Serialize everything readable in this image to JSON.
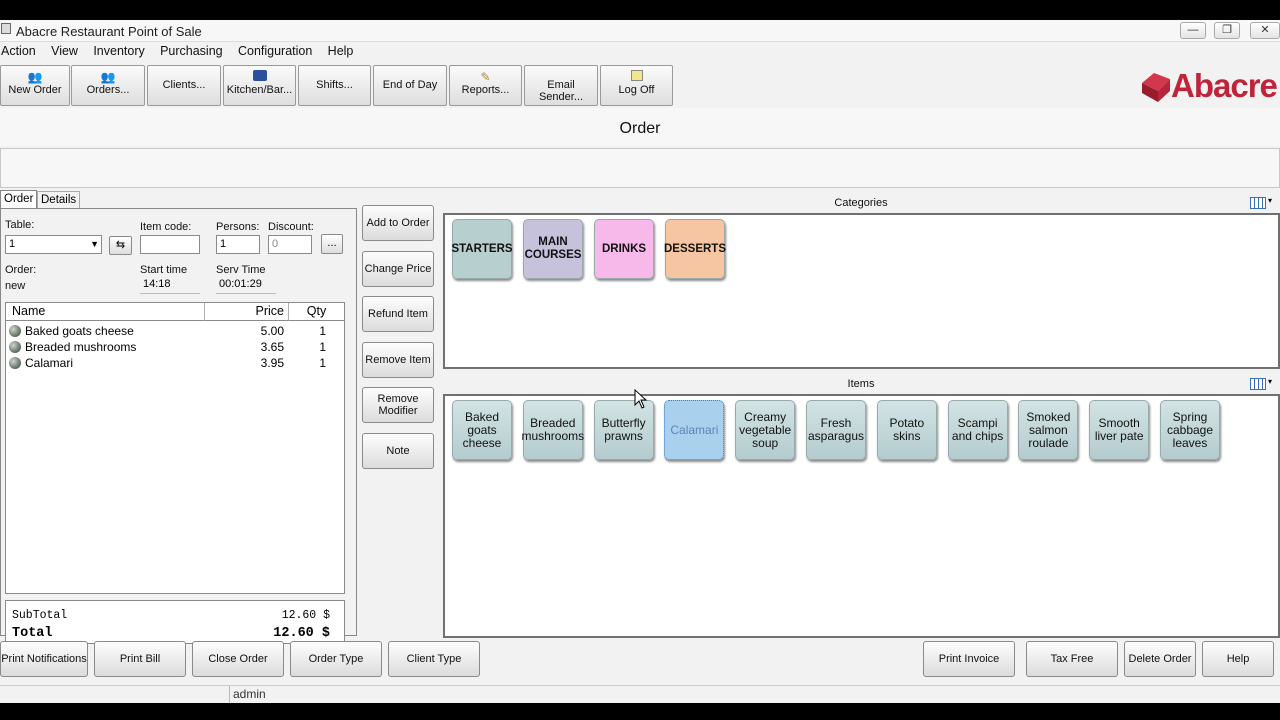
{
  "window": {
    "title": "Abacre Restaurant Point of Sale",
    "min": "—",
    "max": "❐",
    "close": "✕"
  },
  "menu": [
    "Action",
    "View",
    "Inventory",
    "Purchasing",
    "Configuration",
    "Help"
  ],
  "toolbar": [
    {
      "label": "New Order",
      "icon": "new-order-icon"
    },
    {
      "label": "Orders...",
      "icon": "orders-icon"
    },
    {
      "label": "Clients...",
      "icon": ""
    },
    {
      "label": "Kitchen/Bar...",
      "icon": "kitchen-icon"
    },
    {
      "label": "Shifts...",
      "icon": ""
    },
    {
      "label": "End of Day",
      "icon": ""
    },
    {
      "label": "Reports...",
      "icon": "reports-icon"
    },
    {
      "label": "Email Sender...",
      "icon": ""
    },
    {
      "label": "Log Off",
      "icon": "log-off-icon"
    }
  ],
  "logo": {
    "text": "Abacre",
    "color": "#c0243a"
  },
  "header": {
    "title": "Order"
  },
  "tabs": [
    "Order",
    "Details"
  ],
  "order_form": {
    "table_label": "Table:",
    "table_value": "1",
    "item_code_label": "Item code:",
    "item_code_value": "",
    "persons_label": "Persons:",
    "persons_value": "1",
    "discount_label": "Discount:",
    "discount_value": "0",
    "discount_button": "...",
    "order_label": "Order:",
    "order_value": "new",
    "start_time_label": "Start time",
    "start_time_value": "14:18",
    "serv_time_label": "Serv Time",
    "serv_time_value": "00:01:29"
  },
  "order_table": {
    "columns": [
      "Name",
      "Price",
      "Qty"
    ],
    "rows": [
      {
        "name": "Baked goats cheese",
        "price": "5.00",
        "qty": "1"
      },
      {
        "name": "Breaded mushrooms",
        "price": "3.65",
        "qty": "1"
      },
      {
        "name": "Calamari",
        "price": "3.95",
        "qty": "1"
      }
    ]
  },
  "totals": {
    "subtotal_label": "SubTotal",
    "subtotal_value": "12.60 $",
    "total_label": "Total",
    "total_value": "12.60 $"
  },
  "side_buttons": [
    "Add to Order",
    "Change Price",
    "Refund Item",
    "Remove Item",
    "Remove Modifier",
    "Note"
  ],
  "categories": {
    "title": "Categories",
    "tiles": [
      {
        "label": "STARTERS",
        "color": "#b8cfd0"
      },
      {
        "label": "MAIN COURSES",
        "color": "#c6c2dc"
      },
      {
        "label": "DRINKS",
        "color": "#f7b8ea"
      },
      {
        "label": "DESSERTS",
        "color": "#f6c6a2"
      }
    ]
  },
  "items": {
    "title": "Items",
    "tiles": [
      {
        "label": "Baked goats cheese",
        "selected": false
      },
      {
        "label": "Breaded mushrooms",
        "selected": false
      },
      {
        "label": "Butterfly prawns",
        "selected": false
      },
      {
        "label": "Calamari",
        "selected": true
      },
      {
        "label": "Creamy vegetable soup",
        "selected": false
      },
      {
        "label": "Fresh asparagus",
        "selected": false
      },
      {
        "label": "Potato skins",
        "selected": false
      },
      {
        "label": "Scampi and chips",
        "selected": false
      },
      {
        "label": "Smoked salmon roulade",
        "selected": false
      },
      {
        "label": "Smooth liver pate",
        "selected": false
      },
      {
        "label": "Spring cabbage leaves",
        "selected": false
      }
    ]
  },
  "bottom_buttons_left": [
    "Print Notifications",
    "Print Bill",
    "Close Order",
    "Order Type",
    "Client Type"
  ],
  "bottom_buttons_right": [
    "Print Invoice",
    "Tax Free",
    "Delete Order",
    "Help"
  ],
  "status": {
    "user": "admin"
  }
}
